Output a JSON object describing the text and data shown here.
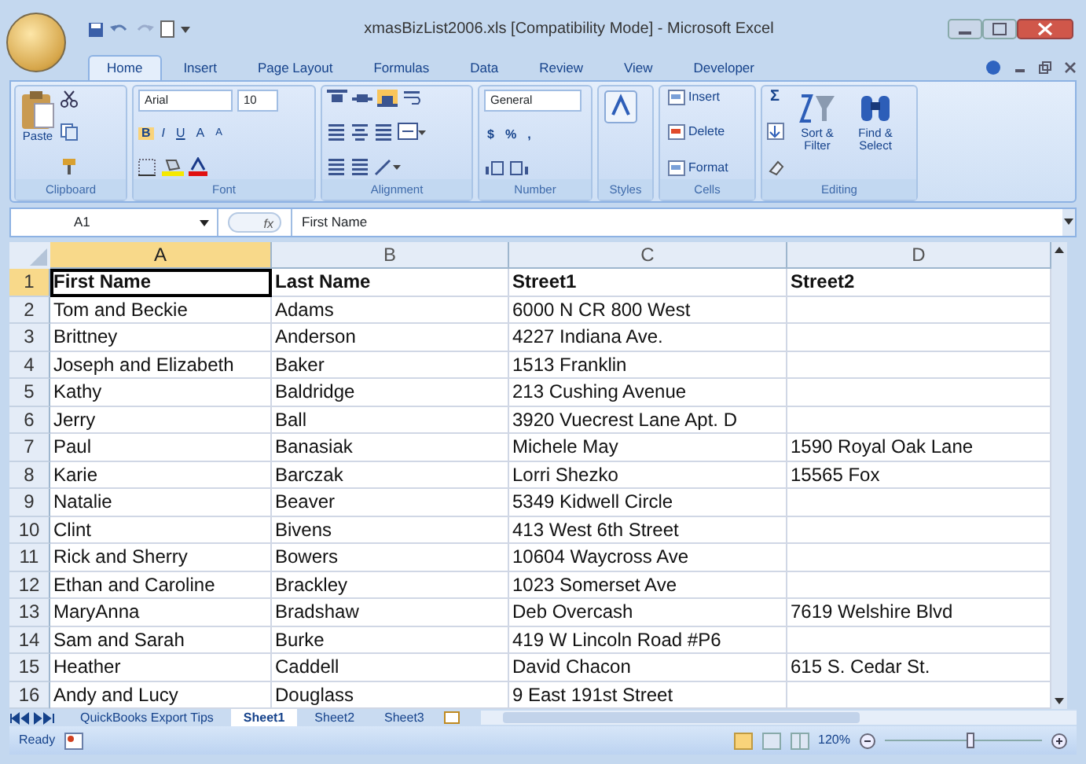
{
  "window": {
    "title": "xmasBizList2006.xls  [Compatibility Mode] - Microsoft Excel"
  },
  "ribbon_tabs": [
    {
      "label": "Home",
      "selected": true
    },
    {
      "label": "Insert",
      "selected": false
    },
    {
      "label": "Page Layout",
      "selected": false
    },
    {
      "label": "Formulas",
      "selected": false
    },
    {
      "label": "Data",
      "selected": false
    },
    {
      "label": "Review",
      "selected": false
    },
    {
      "label": "View",
      "selected": false
    },
    {
      "label": "Developer",
      "selected": false
    }
  ],
  "ribbon": {
    "clipboard": {
      "label": "Clipboard",
      "paste": "Paste"
    },
    "font": {
      "label": "Font",
      "font_name": "Arial",
      "font_size": "10",
      "buttons": [
        "B",
        "I",
        "U",
        "A",
        "A"
      ]
    },
    "alignment": {
      "label": "Alignment"
    },
    "number": {
      "label": "Number",
      "format": "General",
      "buttons": [
        "$",
        "%",
        ","
      ]
    },
    "styles": {
      "label": "Styles"
    },
    "cells": {
      "label": "Cells",
      "menus": [
        "Insert",
        "Delete",
        "Format"
      ]
    },
    "editing": {
      "label": "Editing",
      "sum": "Σ",
      "buttons": [
        "Sort & Filter",
        "Find & Select"
      ]
    }
  },
  "formula_bar": {
    "name_box": "A1",
    "fx": "fx",
    "formula": "First Name"
  },
  "sheet": {
    "columns": [
      {
        "label": "A",
        "selected": true
      },
      {
        "label": "B",
        "selected": false
      },
      {
        "label": "C",
        "selected": false
      },
      {
        "label": "D",
        "selected": false
      }
    ],
    "rows": [
      {
        "number": "1",
        "selected": true,
        "bold": true,
        "cells": [
          "First Name",
          "Last Name",
          "Street1",
          "Street2"
        ]
      },
      {
        "number": "2",
        "selected": false,
        "bold": false,
        "cells": [
          "Tom and Beckie",
          "Adams",
          "6000 N CR 800 West",
          ""
        ]
      },
      {
        "number": "3",
        "selected": false,
        "bold": false,
        "cells": [
          "Brittney",
          "Anderson",
          "4227 Indiana Ave.",
          ""
        ]
      },
      {
        "number": "4",
        "selected": false,
        "bold": false,
        "cells": [
          "Joseph and Elizabeth",
          "Baker",
          "1513 Franklin",
          ""
        ]
      },
      {
        "number": "5",
        "selected": false,
        "bold": false,
        "cells": [
          "Kathy",
          "Baldridge",
          "213 Cushing Avenue",
          ""
        ]
      },
      {
        "number": "6",
        "selected": false,
        "bold": false,
        "cells": [
          "Jerry",
          "Ball",
          "3920 Vuecrest Lane Apt. D",
          ""
        ]
      },
      {
        "number": "7",
        "selected": false,
        "bold": false,
        "cells": [
          "Paul",
          "Banasiak",
          "Michele May",
          "1590 Royal Oak Lane"
        ]
      },
      {
        "number": "8",
        "selected": false,
        "bold": false,
        "cells": [
          "Karie",
          "Barczak",
          "Lorri Shezko",
          "15565 Fox"
        ]
      },
      {
        "number": "9",
        "selected": false,
        "bold": false,
        "cells": [
          "Natalie",
          "Beaver",
          "5349 Kidwell Circle",
          ""
        ]
      },
      {
        "number": "10",
        "selected": false,
        "bold": false,
        "cells": [
          "Clint",
          "Bivens",
          "413 West 6th Street",
          ""
        ]
      },
      {
        "number": "11",
        "selected": false,
        "bold": false,
        "cells": [
          "Rick and Sherry",
          "Bowers",
          "10604 Waycross Ave",
          ""
        ]
      },
      {
        "number": "12",
        "selected": false,
        "bold": false,
        "cells": [
          "Ethan and Caroline",
          "Brackley",
          "1023 Somerset Ave",
          ""
        ]
      },
      {
        "number": "13",
        "selected": false,
        "bold": false,
        "cells": [
          "MaryAnna",
          "Bradshaw",
          "Deb Overcash",
          "7619 Welshire Blvd"
        ]
      },
      {
        "number": "14",
        "selected": false,
        "bold": false,
        "cells": [
          "Sam and Sarah",
          "Burke",
          "419 W Lincoln Road #P6",
          ""
        ]
      },
      {
        "number": "15",
        "selected": false,
        "bold": false,
        "cells": [
          "Heather",
          "Caddell",
          "David Chacon",
          "615 S. Cedar St."
        ]
      },
      {
        "number": "16",
        "selected": false,
        "bold": false,
        "cells": [
          "Andy and Lucy",
          "Douglass",
          "9 East 191st Street",
          ""
        ]
      }
    ]
  },
  "sheet_tabs": [
    {
      "label": "QuickBooks Export Tips",
      "selected": false
    },
    {
      "label": "Sheet1",
      "selected": true
    },
    {
      "label": "Sheet2",
      "selected": false
    },
    {
      "label": "Sheet3",
      "selected": false
    }
  ],
  "status_bar": {
    "status": "Ready",
    "zoom": "120%",
    "zoom_slider": {
      "level": 0.55
    }
  }
}
